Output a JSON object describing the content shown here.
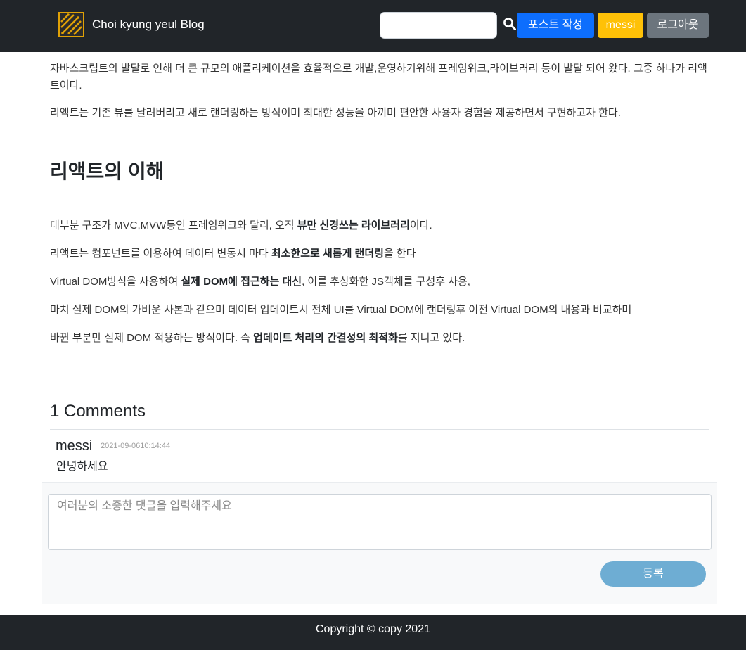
{
  "nav": {
    "brand": "Choi kyung yeul Blog",
    "search_placeholder": "",
    "write_label": "포스트 작성",
    "user_label": "messi",
    "logout_label": "로그아웃",
    "logo_icon": "circuit-logo-icon",
    "search_icon": "search-icon"
  },
  "article": {
    "intro_p1": "자바스크립트의 발달로 인해 더 큰 규모의 애플리케이션을 효율적으로 개발,운영하기위해 프레임워크,라이브러리 등이 발달 되어 왔다. 그중 하나가 리액트이다.",
    "intro_p2": "리액트는 기존 뷰를 날려버리고 새로 랜더링하는 방식이며 최대한 성능을 아끼며 편안한 사용자 경험을 제공하면서 구현하고자 한다.",
    "heading": "리액트의 이해",
    "p1": {
      "before": "대부분 구조가 MVC,MVW등인 프레임워크와 달리, 오직 ",
      "bold": "뷰만 신경쓰는 라이브러리",
      "after": "이다."
    },
    "p2": {
      "before": "리액트는 컴포넌트를 이용하여 데이터 변동시 마다 ",
      "bold": "최소한으로 새롭게 랜더링",
      "after": "을 한다"
    },
    "p3": {
      "before": "Virtual DOM방식을 사용하여 ",
      "bold": "실제 DOM에 접근하는 대신",
      "after": ", 이를 추상화한 JS객체를 구성후 사용,"
    },
    "p4": "마치 실제 DOM의 가벼운 사본과 같으며 데이터 업데이트시 전체 UI를 Virtual DOM에 랜더링후 이전 Virtual DOM의 내용과 비교하며",
    "p5": {
      "before": "바뀐 부분만 실제 DOM 적용하는 방식이다. 즉 ",
      "bold": "업데이트 처리의 간결성의 최적화",
      "after": "를 지니고 있다."
    }
  },
  "comments": {
    "title": "1 Comments",
    "items": [
      {
        "author": "messi",
        "date": "2021-09-0610:14:44",
        "body": "안녕하세요"
      }
    ],
    "placeholder": "여러분의 소중한 댓글을 입력해주세요",
    "submit_label": "등록"
  },
  "footer": {
    "copyright": "Copyright © copy 2021"
  },
  "colors": {
    "navbar": "#212529",
    "primary": "#0d6efd",
    "warning": "#ffc107",
    "secondary": "#6c757d",
    "submit": "#6eadd3"
  }
}
